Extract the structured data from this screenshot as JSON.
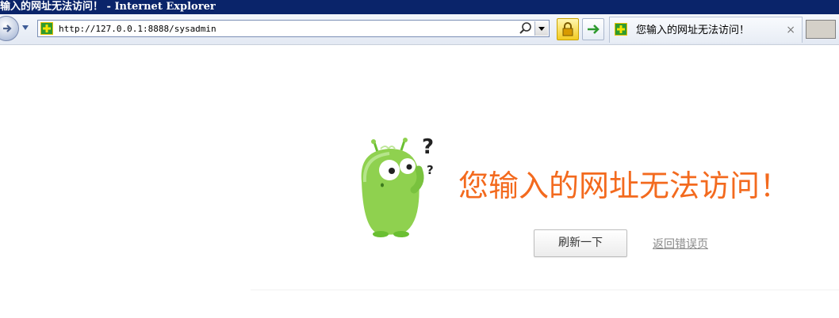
{
  "window": {
    "title": "输入的网址无法访问！ - Internet Explorer"
  },
  "toolbar": {
    "url": "http://127.0.0.1:8888/sysadmin",
    "tab_label": "您输入的网址无法访问！",
    "tab_close": "×",
    "icons": [
      "back-icon",
      "dropdown-icon",
      "site-icon",
      "search-icon",
      "lock-icon",
      "go-arrow-icon",
      "tab-close-icon"
    ]
  },
  "error": {
    "title": "您输入的网址无法访问！",
    "refresh_label": "刷新一下",
    "back_label": "返回错误页"
  },
  "colors": {
    "title_bar": "#0a246a",
    "error_title": "#f36a1e",
    "mascot": "#8fd14f",
    "link": "#888888"
  }
}
